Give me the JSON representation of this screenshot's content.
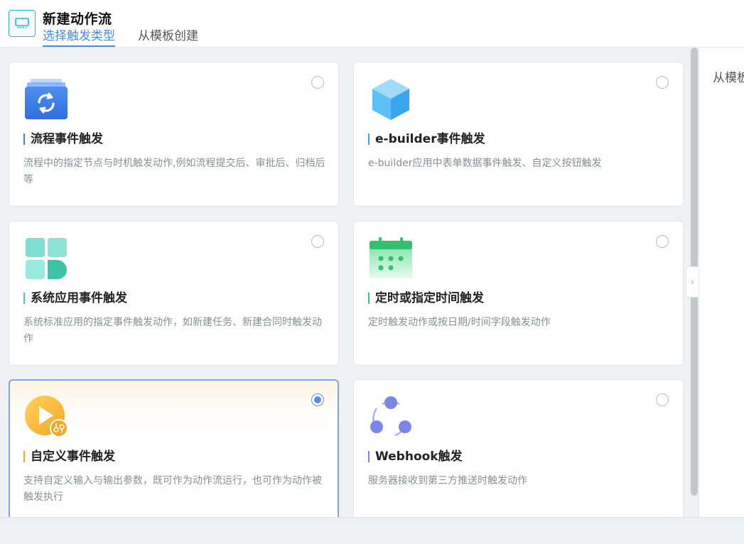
{
  "header": {
    "title": "新建动作流",
    "icon": "monitor-icon",
    "tabs": [
      {
        "label": "选择触发类型",
        "active": true
      },
      {
        "label": "从模板创建",
        "active": false
      }
    ]
  },
  "cards": [
    {
      "title": "流程事件触发",
      "desc": "流程中的指定节点与时机触发动作,例如流程提交后、审批后、归档后等",
      "icon": "workflow-refresh-icon",
      "accent": "#3d7fe0",
      "selected": false
    },
    {
      "title": "e-builder事件触发",
      "desc": "e-builder应用中表单数据事件触发、自定义按钮触发",
      "icon": "cube-icon",
      "accent": "#3aa6e8",
      "selected": false
    },
    {
      "title": "系统应用事件触发",
      "desc": "系统标准应用的指定事件触发动作，如新建任务、新建合同时触发动作",
      "icon": "apps-grid-icon",
      "accent": "#4cc9b8",
      "selected": false
    },
    {
      "title": "定时或指定时间触发",
      "desc": "定时触发动作或按日期/时间字段触发动作",
      "icon": "calendar-icon",
      "accent": "#34c97a",
      "selected": false
    },
    {
      "title": "自定义事件触发",
      "desc": "支持自定义输入与输出参数，既可作为动作流运行，也可作为动作被触发执行",
      "icon": "play-custom-icon",
      "accent": "#f5a623",
      "selected": true
    },
    {
      "title": "Webhook触发",
      "desc": "服务器接收到第三方推送时触发动作",
      "icon": "webhook-icon",
      "accent": "#7b85e8",
      "selected": false
    }
  ],
  "right_panel": {
    "label": "从模板"
  },
  "colors": {
    "primary": "#4a8ae0",
    "selected_border": "#7aa7e8"
  }
}
